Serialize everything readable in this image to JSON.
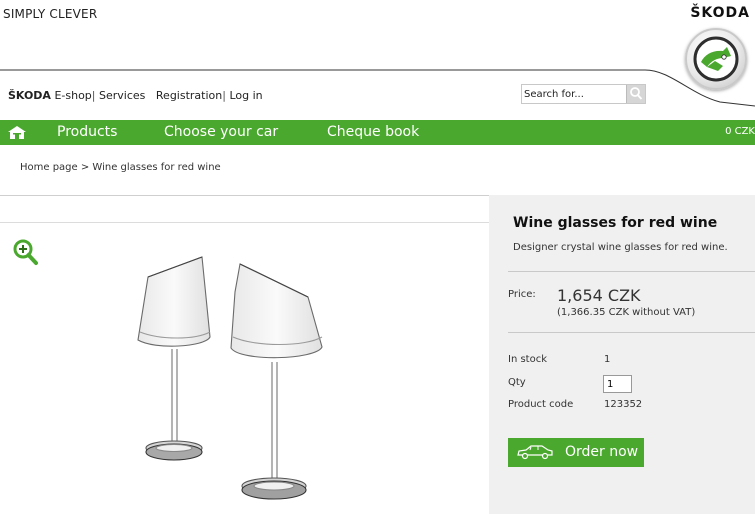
{
  "header": {
    "slogan": "SIMPLY CLEVER",
    "brand": "ŠKODA",
    "logo_icon": "skoda-winged-arrow-logo",
    "colors": {
      "brand_green": "#4ba82e",
      "panel_bg": "#f0f0f0"
    }
  },
  "toplinks": {
    "shop_prefix": "ŠKODA",
    "shop_label": "E-shop",
    "sep": "|",
    "services": "Services",
    "registration": "Registration",
    "login": "Log in"
  },
  "search": {
    "value": "Search for...",
    "icon": "magnifier-icon"
  },
  "nav": {
    "home_icon": "home-icon",
    "items": [
      "Products",
      "Choose your car",
      "Cheque book"
    ],
    "cart": "0 CZK"
  },
  "breadcrumb": "Home page > Wine glasses for red wine",
  "product": {
    "title": "Wine glasses for red wine",
    "description": "Designer crystal wine glasses for red wine.",
    "price_label": "Price:",
    "price": "1,654 CZK",
    "price_without_vat": "(1,366.35 CZK without VAT)",
    "in_stock_label": "In stock",
    "in_stock_value": "1",
    "qty_label": "Qty",
    "qty_value": "1",
    "code_label": "Product code",
    "code_value": "123352",
    "order_label": "Order now",
    "order_icon": "car-icon",
    "zoom_icon": "zoom-in-icon"
  }
}
